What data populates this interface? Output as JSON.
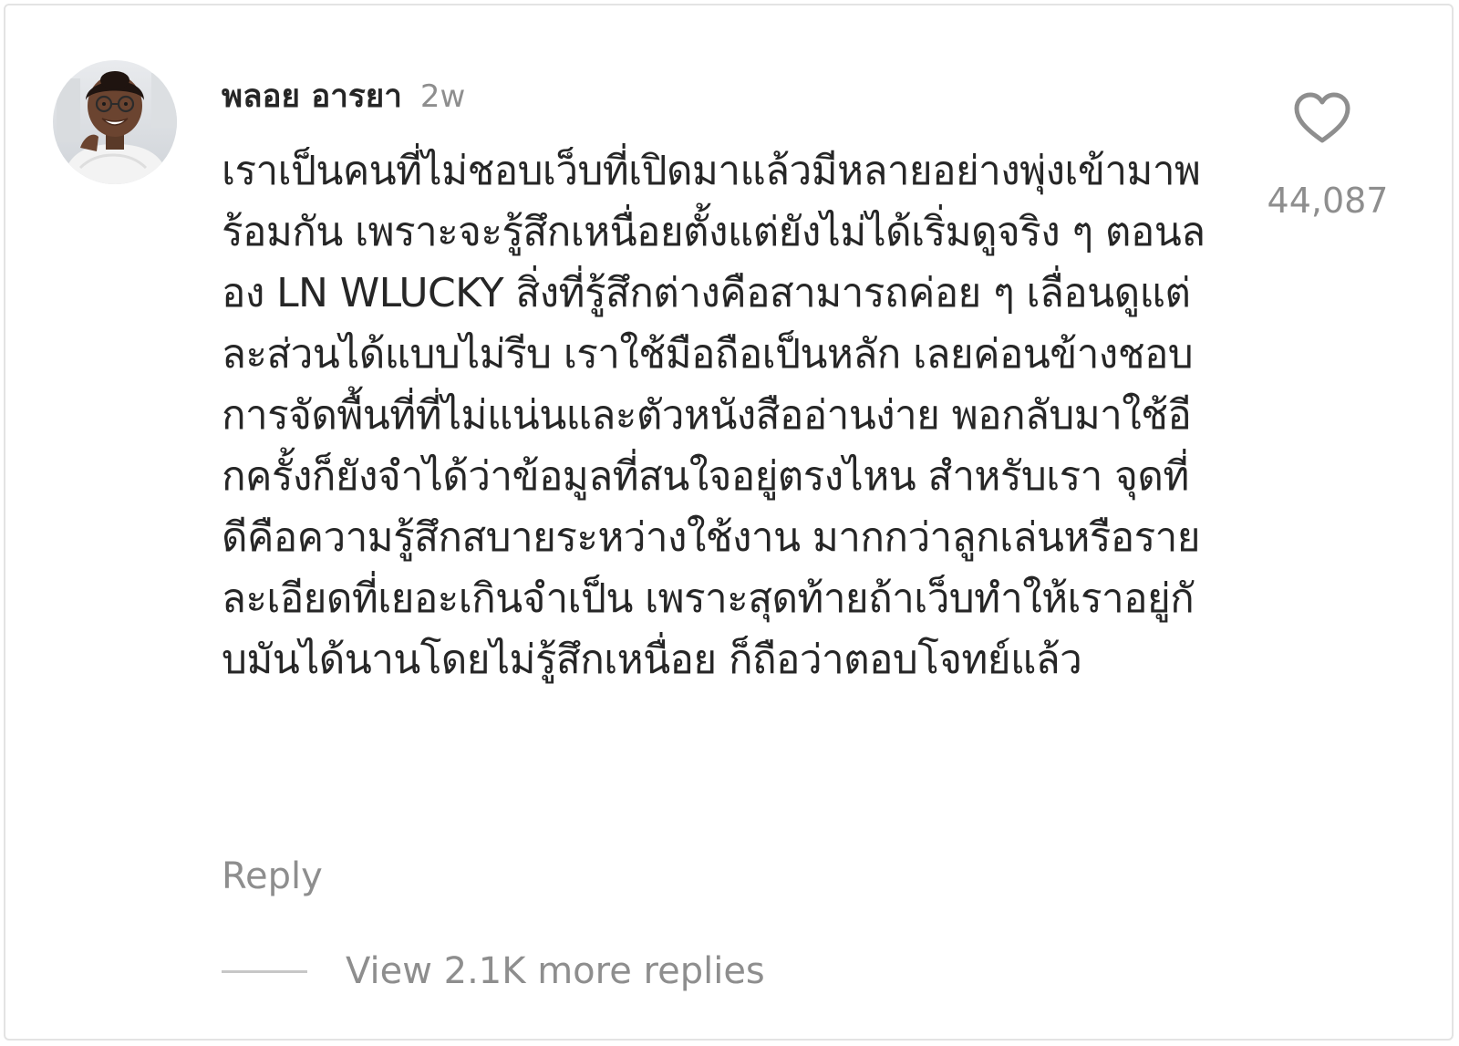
{
  "comment": {
    "username": "พลอย อารยา",
    "timestamp": "2w",
    "text": "เราเป็นคนที่ไม่ชอบเว็บที่เปิดมาแล้วมีหลายอย่างพุ่งเข้ามาพร้อมกัน เพราะจะรู้สึกเหนื่อยตั้งแต่ยังไม่ได้เริ่มดูจริง ๆ ตอนลอง LN WLUCKY สิ่งที่รู้สึกต่างคือสามารถค่อย ๆ เลื่อนดูแต่ละส่วนได้แบบไม่รีบ เราใช้มือถือเป็นหลัก เลยค่อนข้างชอบการจัดพื้นที่ที่ไม่แน่นและตัวหนังสืออ่านง่าย พอกลับมาใช้อีกครั้งก็ยังจำได้ว่าข้อมูลที่สนใจอยู่ตรงไหน สำหรับเรา จุดที่ดีคือความรู้สึกสบายระหว่างใช้งาน มากกว่าลูกเล่นหรือรายละเอียดที่เยอะเกินจำเป็น เพราะสุดท้ายถ้าเว็บทำให้เราอยู่กับมันได้นานโดยไม่รู้สึกเหนื่อย ก็ถือว่าตอบโจทย์แล้ว",
    "like_count": "44,087",
    "like_icon": "heart-outline-icon",
    "reply_label": "Reply",
    "view_replies_label": "View 2.1K more replies"
  },
  "colors": {
    "primary_text": "#262626",
    "secondary_text": "#8e8e8e",
    "divider": "#c7c7c7",
    "border": "#e3e3e3"
  }
}
